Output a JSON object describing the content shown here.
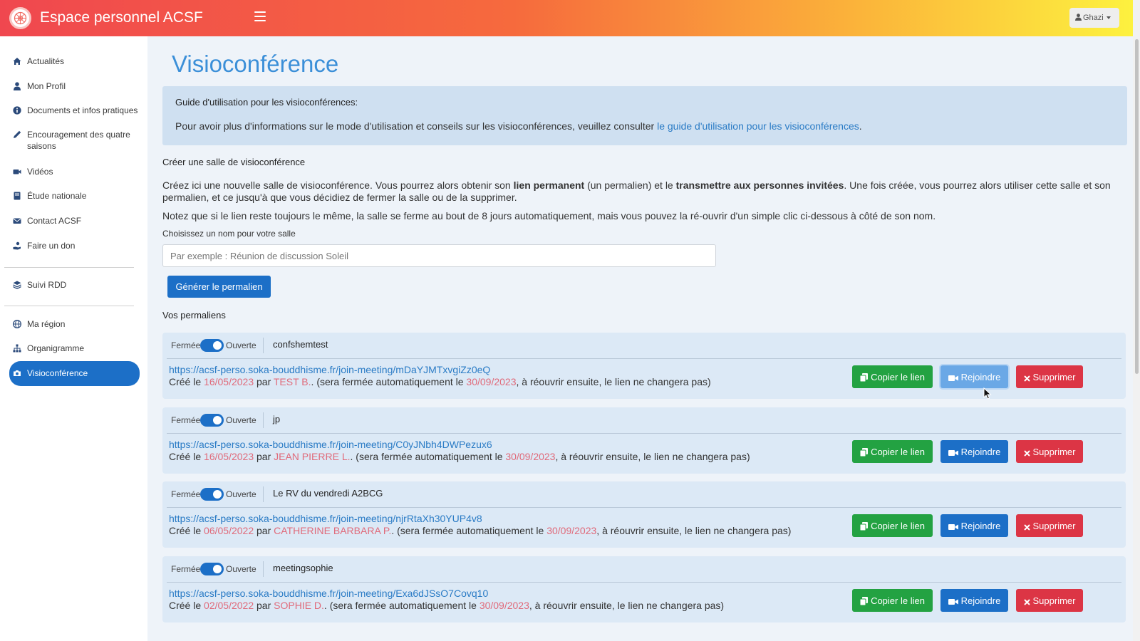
{
  "header": {
    "app_title": "Espace personnel ACSF",
    "user_name": "Ghazi",
    "gradient_colors": [
      "#f0474f",
      "#f66a3d",
      "#fbb33a",
      "#fdf33f"
    ]
  },
  "sidebar": {
    "items": [
      {
        "label": "Actualités",
        "icon": "home-icon"
      },
      {
        "label": "Mon Profil",
        "icon": "user-icon"
      },
      {
        "label": "Documents et infos pratiques",
        "icon": "info-icon"
      },
      {
        "label": "Encouragement des quatre saisons",
        "icon": "pen-icon"
      },
      {
        "label": "Vidéos",
        "icon": "video-icon"
      },
      {
        "label": "Étude nationale",
        "icon": "book-icon"
      },
      {
        "label": "Contact ACSF",
        "icon": "envelope-icon"
      },
      {
        "label": "Faire un don",
        "icon": "donate-icon"
      },
      {
        "label": "Suivi RDD",
        "icon": "layers-icon"
      },
      {
        "label": "Ma région",
        "icon": "globe-icon"
      },
      {
        "label": "Organigramme",
        "icon": "sitemap-icon"
      },
      {
        "label": "Visioconférence",
        "icon": "camera-icon",
        "active": true
      }
    ]
  },
  "main": {
    "title": "Visioconférence",
    "guide": {
      "title": "Guide d'utilisation pour les visioconférences:",
      "text_before": "Pour avoir plus d'informations sur le mode d'utilisation et conseils sur les visioconférences, veuillez consulter ",
      "link_text": "le guide d'utilisation pour les visioconférences",
      "text_after": "."
    },
    "create": {
      "title": "Créer une salle de visioconférence",
      "desc_part1": "Créez ici une nouvelle salle de visioconférence. Vous pourrez alors obtenir son ",
      "desc_bold1": "lien permanent",
      "desc_part2": " (un permalien) et le ",
      "desc_bold2": "transmettre aux personnes invitées",
      "desc_part3": ". Une fois créée, vous pourrez alors utiliser cette salle et son permalien, et ce jusqu'à que vous décidiez de fermer la salle ou de la supprimer.",
      "note": "Notez que si le lien reste toujours le même, la salle se ferme au bout de 8 jours automatiquement, mais vous pouvez la ré-ouvrir d'un simple clic ci-dessous à côté de son nom.",
      "field_label": "Choisissez un nom pour votre salle",
      "input_placeholder": "Par exemple : Réunion de discussion Soleil",
      "input_value": "",
      "generate_button": "Générer le permalien"
    },
    "list_title": "Vos permaliens",
    "labels": {
      "closed": "Fermée",
      "open": "Ouverte",
      "created": "Créé le",
      "by": "par",
      "auto_close": "(sera fermée automatiquement le",
      "reopen_note": ", à réouvrir ensuite, le lien ne changera pas)",
      "copy": "Copier le lien",
      "join": "Rejoindre",
      "delete": "Supprimer"
    },
    "rooms": [
      {
        "name": "confshemtest",
        "is_open": true,
        "link": "https://acsf-perso.soka-bouddhisme.fr/join-meeting/mDaYJMTxvgiZz0eQ",
        "created": "16/05/2023",
        "author": "TEST B.",
        "closes": "30/09/2023"
      },
      {
        "name": "jp",
        "is_open": true,
        "link": "https://acsf-perso.soka-bouddhisme.fr/join-meeting/C0yJNbh4DWPezux6",
        "created": "16/05/2023",
        "author": "JEAN PIERRE L.",
        "closes": "30/09/2023"
      },
      {
        "name": "Le RV du vendredi A2BCG",
        "is_open": true,
        "link": "https://acsf-perso.soka-bouddhisme.fr/join-meeting/njrRtaXh30YUP4v8",
        "created": "06/05/2022",
        "author": "CATHERINE BARBARA P.",
        "closes": "30/09/2023"
      },
      {
        "name": "meetingsophie",
        "is_open": true,
        "link": "https://acsf-perso.soka-bouddhisme.fr/join-meeting/Exa6dJSsO7Covq10",
        "created": "02/05/2022",
        "author": "SOPHIE D.",
        "closes": "30/09/2023"
      }
    ]
  },
  "colors": {
    "primary": "#1c6fc7",
    "success": "#23a242",
    "danger": "#dc3545",
    "title": "#3b8fd8",
    "link": "#2a7bc5",
    "accent_text": "#e06a7a"
  }
}
